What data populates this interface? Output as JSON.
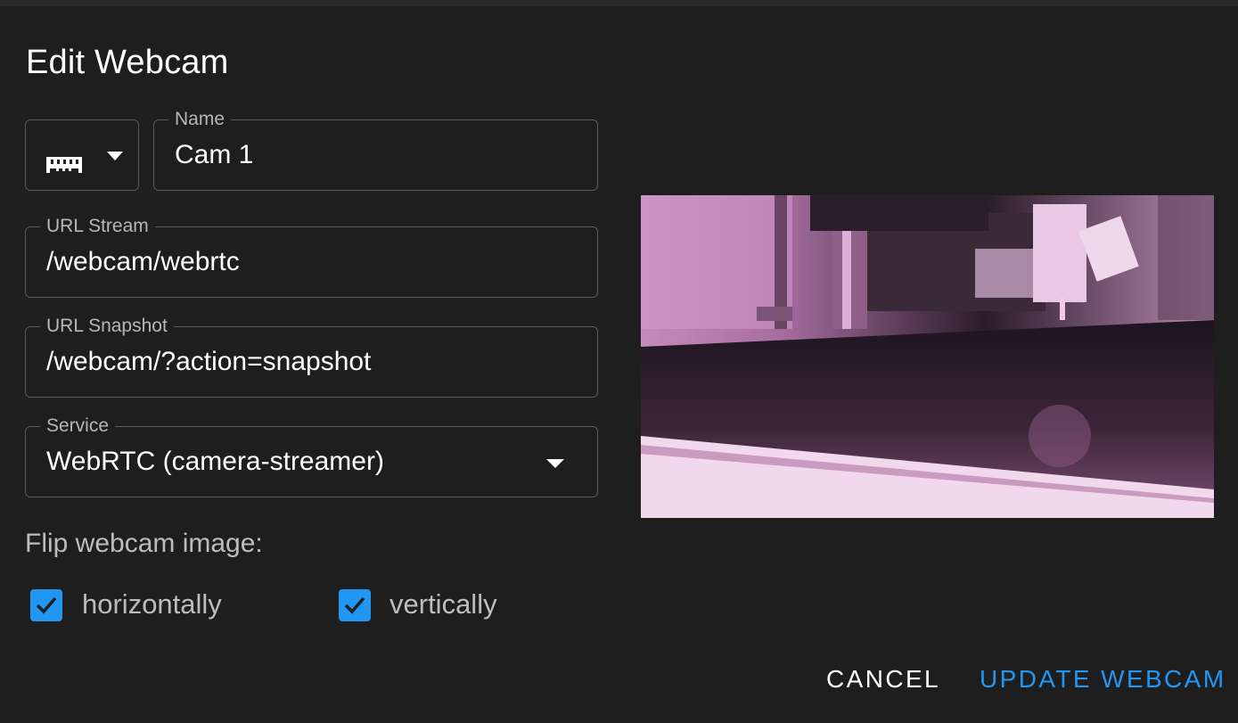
{
  "dialog": {
    "title": "Edit Webcam"
  },
  "form": {
    "icon_select": {
      "icon": "memory-icon"
    },
    "name": {
      "label": "Name",
      "value": "Cam 1"
    },
    "url_stream": {
      "label": "URL Stream",
      "value": "/webcam/webrtc"
    },
    "url_snapshot": {
      "label": "URL Snapshot",
      "value": "/webcam/?action=snapshot"
    },
    "service": {
      "label": "Service",
      "value": "WebRTC (camera-streamer)"
    }
  },
  "flip": {
    "label": "Flip webcam image:",
    "horizontal": {
      "label": "horizontally",
      "checked": true
    },
    "vertical": {
      "label": "vertically",
      "checked": true
    }
  },
  "actions": {
    "cancel_label": "CANCEL",
    "update_label": "UPDATE WEBCAM"
  },
  "colors": {
    "background": "#1e1e1e",
    "accent": "#2196f3",
    "outline": "#5a5a5a",
    "label": "#b7b7b7"
  }
}
